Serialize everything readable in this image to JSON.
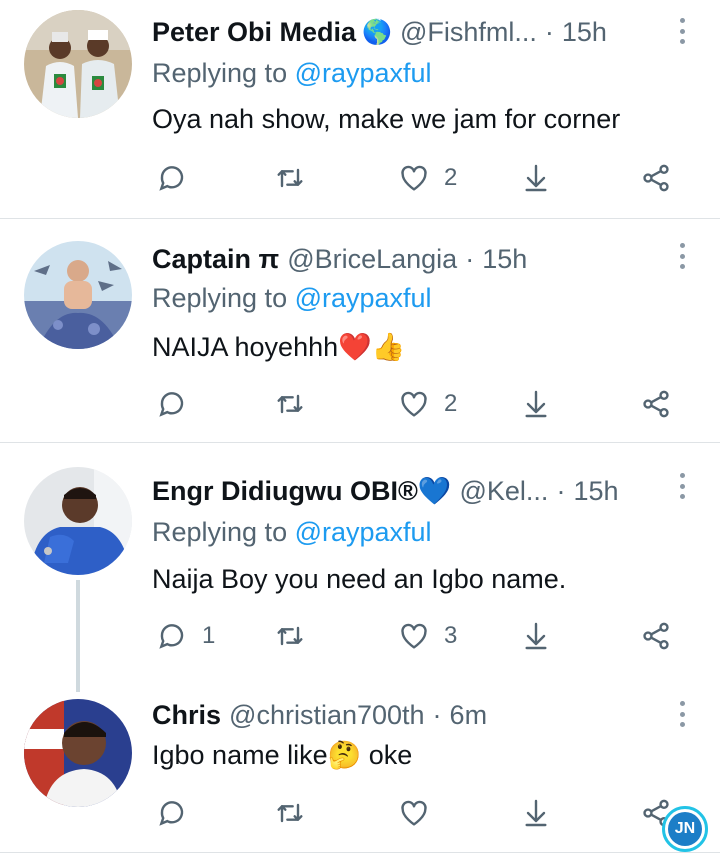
{
  "tweets": [
    {
      "name": "Peter Obi Media",
      "badge": "🌎",
      "handle": "@Fishfml...",
      "dot": "·",
      "time": "15h",
      "replying_prefix": "Replying to ",
      "replying_to": "@raypaxful",
      "text": "Oya nah show, make we jam for corner",
      "counts": {
        "reply": "",
        "retweet": "",
        "like": "2"
      }
    },
    {
      "name": "Captain π",
      "badge": "",
      "handle": "@BriceLangia",
      "dot": "·",
      "time": "15h",
      "replying_prefix": "Replying to ",
      "replying_to": "@raypaxful",
      "text": "NAIJA hoyehhh❤️👍",
      "counts": {
        "reply": "",
        "retweet": "",
        "like": "2"
      }
    },
    {
      "name": "Engr Didiugwu OBI®💙",
      "badge": "",
      "handle": "@Kel...",
      "dot": "·",
      "time": "15h",
      "replying_prefix": "Replying to ",
      "replying_to": "@raypaxful",
      "text": "Naija Boy you need an Igbo name.",
      "counts": {
        "reply": "1",
        "retweet": "",
        "like": "3"
      }
    },
    {
      "name": "Chris",
      "badge": "",
      "handle": "@christian700th",
      "dot": "·",
      "time": "6m",
      "text": "Igbo name like🤔  oke",
      "counts": {
        "reply": "",
        "retweet": "",
        "like": ""
      }
    }
  ],
  "watermark": {
    "text": "JN"
  },
  "colors": {
    "accent": "#1d9bf0",
    "muted": "#536471",
    "text": "#0f1419",
    "divider": "#dfe3e6"
  },
  "icons": [
    "reply-icon",
    "retweet-icon",
    "like-icon",
    "download-icon",
    "share-icon",
    "more-icon"
  ]
}
